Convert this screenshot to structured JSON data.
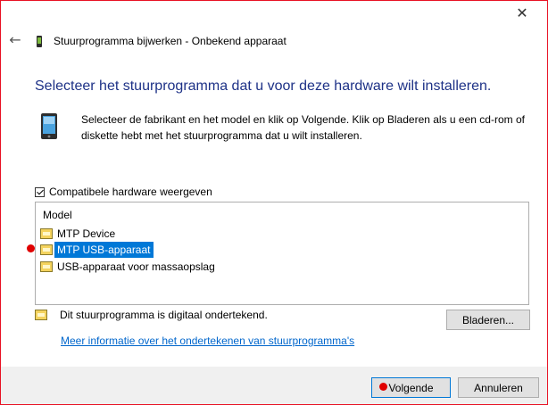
{
  "window": {
    "title": "Stuurprogramma bijwerken - Onbekend apparaat",
    "close_icon": "close-icon",
    "back_icon": "back-arrow-icon"
  },
  "main": {
    "heading": "Selecteer het stuurprogramma dat u voor deze hardware wilt installeren.",
    "description": "Selecteer de fabrikant en het model en klik op Volgende. Klik op Bladeren als u een cd-rom of diskette hebt met het stuurprogramma dat u wilt installeren.",
    "compatible_checkbox": {
      "label": "Compatibele hardware weergeven",
      "checked": true
    },
    "model_list": {
      "header": "Model",
      "items": [
        {
          "label": "MTP Device",
          "selected": false
        },
        {
          "label": "MTP USB-apparaat",
          "selected": true
        },
        {
          "label": "USB-apparaat voor massaopslag",
          "selected": false
        }
      ]
    },
    "signed_text": "Dit stuurprogramma is digitaal ondertekend.",
    "browse_label": "Bladeren...",
    "info_link": "Meer informatie over het ondertekenen van stuurprogramma's"
  },
  "footer": {
    "next_label": "Volgende",
    "cancel_label": "Annuleren"
  },
  "colors": {
    "heading": "#1e3287",
    "selection": "#0078d7",
    "link": "#0066cc",
    "marker": "#e00000"
  }
}
